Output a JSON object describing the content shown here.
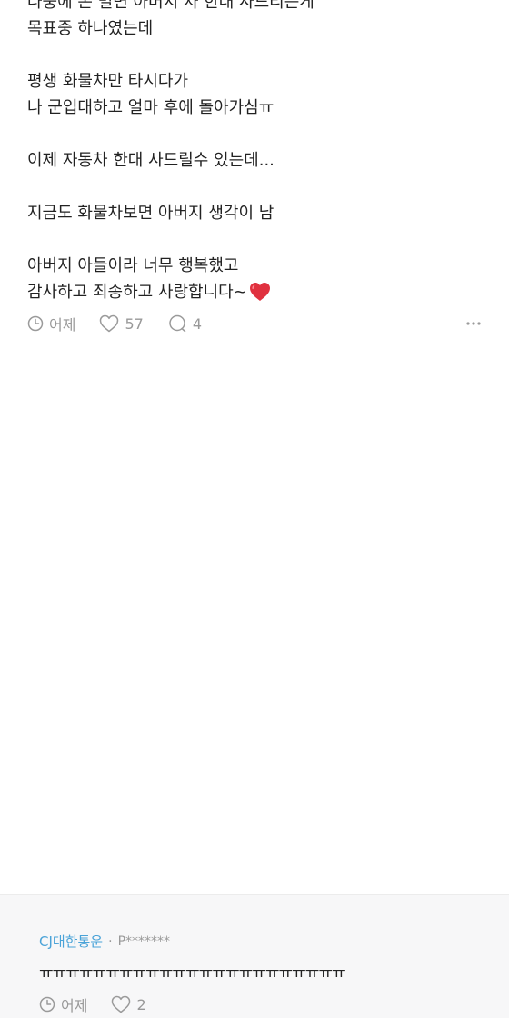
{
  "post": {
    "paragraphs": [
      [
        "나중에 돈 벌면 아버지 차 한대 사드리는게",
        "목표중 하나였는데"
      ],
      [
        "평생 화물차만 타시다가",
        "나 군입대하고 얼마 후에 돌아가심ㅠ"
      ],
      [
        "이제 자동차 한대 사드릴수 있는데..."
      ],
      [
        "지금도 화물차보면 아버지 생각이 남"
      ],
      [
        "아버지 아들이라 너무 행복했고",
        "감사하고 죄송하고 사랑합니다~"
      ]
    ],
    "closing_emoji": "heart-emoji",
    "meta": {
      "time": "어제",
      "likes": "57",
      "comments": "4"
    }
  },
  "comment": {
    "company": "CJ대한통운",
    "separator": "·",
    "user": "P*******",
    "text": "ㅠㅠㅠㅠㅠㅠㅠㅠㅠㅠㅠㅠㅠㅠㅠㅠㅠㅠㅠㅠㅠㅠㅠ",
    "time": "어제",
    "likes": "2"
  },
  "colors": {
    "accent": "#4aa3d8",
    "meta_gray": "#999999",
    "heart_red": "#e0313f",
    "comment_bg": "#f7f7f8"
  }
}
